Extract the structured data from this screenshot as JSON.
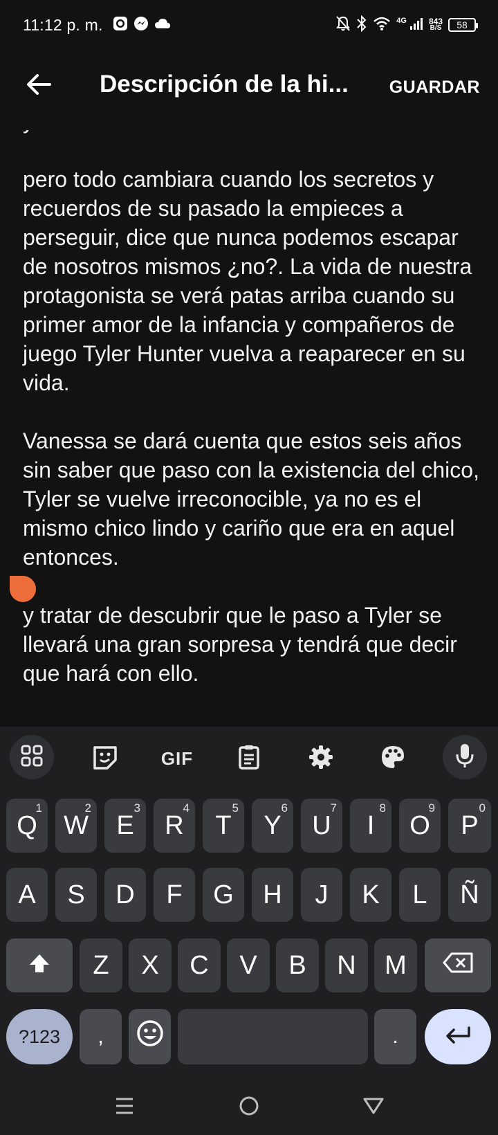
{
  "status_bar": {
    "time": "11:12 p. m.",
    "network_type": "4G",
    "net_speed_value": "843",
    "net_speed_unit": "B/S",
    "battery": "58",
    "icons": [
      "whatsapp-icon",
      "messenger-icon",
      "cloud-icon",
      "mute-bell-icon",
      "bluetooth-icon",
      "wifi-icon",
      "signal-icon",
      "battery-icon"
    ]
  },
  "app_bar": {
    "title": "Descripción de la hi...",
    "save_label": "GUARDAR",
    "back_icon": "arrow-left-icon"
  },
  "editor": {
    "top_partial_line": "y Josel",
    "paragraphs": [
      "pero todo cambiara cuando los secretos y recuerdos de su pasado la empieces a perseguir, dice que nunca podemos escapar de nosotros mismos ¿no?. La vida de nuestra protagonista se verá patas arriba cuando su primer amor de la infancia y compañeros de juego Tyler Hunter vuelva a reaparecer en su vida.",
      "Vanessa se dará cuenta que estos seis años sin saber que paso con la existencia del chico, Tyler se vuelve irreconocible, ya no es el mismo chico lindo y cariño que era en aquel entonces.",
      "y tratar de descubrir que le paso a Tyler se llevará una gran sorpresa y tendrá que decir que hará con ello."
    ]
  },
  "keyboard": {
    "toolbar": {
      "gif_label": "GIF",
      "icons": [
        "apps-grid-icon",
        "sticker-icon",
        "gif-icon",
        "clipboard-icon",
        "settings-icon",
        "palette-icon",
        "microphone-icon"
      ]
    },
    "row1": [
      {
        "key": "Q",
        "hint": "1"
      },
      {
        "key": "W",
        "hint": "2"
      },
      {
        "key": "E",
        "hint": "3"
      },
      {
        "key": "R",
        "hint": "4"
      },
      {
        "key": "T",
        "hint": "5"
      },
      {
        "key": "Y",
        "hint": "6"
      },
      {
        "key": "U",
        "hint": "7"
      },
      {
        "key": "I",
        "hint": "8"
      },
      {
        "key": "O",
        "hint": "9"
      },
      {
        "key": "P",
        "hint": "0"
      }
    ],
    "row2": [
      "A",
      "S",
      "D",
      "F",
      "G",
      "H",
      "J",
      "K",
      "L",
      "Ñ"
    ],
    "row3": [
      "Z",
      "X",
      "C",
      "V",
      "B",
      "N",
      "M"
    ],
    "symbols_label": "?123",
    "comma": ",",
    "period": "."
  },
  "nav_bar": {
    "icons": [
      "menu-icon",
      "home-icon",
      "back-triangle-icon"
    ]
  }
}
